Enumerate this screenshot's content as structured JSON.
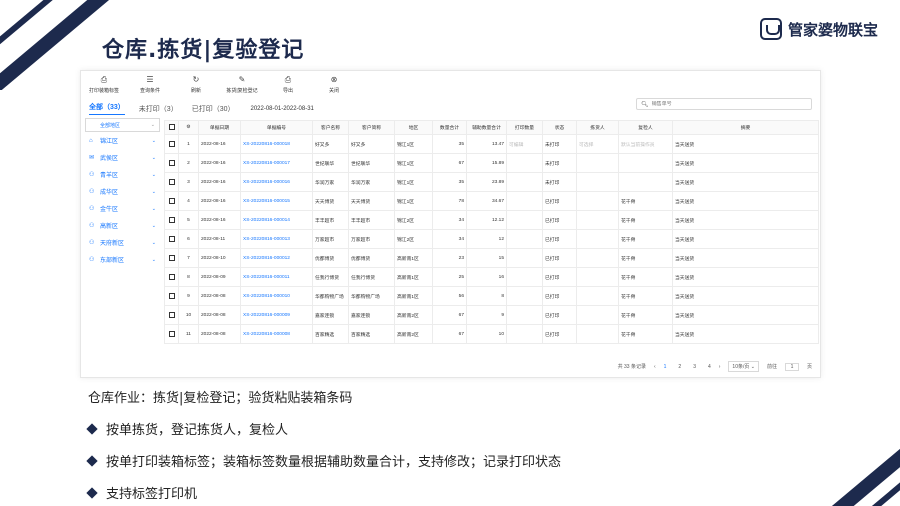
{
  "page": {
    "title": "仓库.拣货|复验登记",
    "brand": "管家婆物联宝"
  },
  "toolbar": [
    {
      "label": "打印装箱标签",
      "icon": "printer-icon"
    },
    {
      "label": "查询条件",
      "icon": "filter-icon"
    },
    {
      "label": "刷新",
      "icon": "refresh-icon"
    },
    {
      "label": "拣货|复检登记",
      "icon": "edit-icon"
    },
    {
      "label": "导出",
      "icon": "export-icon"
    },
    {
      "label": "关闭",
      "icon": "close-icon"
    }
  ],
  "tabs": [
    {
      "label": "全部（33）",
      "active": true
    },
    {
      "label": "未打印（3）",
      "active": false
    },
    {
      "label": "已打印（30）",
      "active": false
    }
  ],
  "date_range": "2022-08-01-2022-08-31",
  "search": {
    "placeholder": "销售单号"
  },
  "sidebar": {
    "select": "全部地区",
    "items": [
      {
        "label": "锦江区",
        "icon": "home-icon"
      },
      {
        "label": "武侯区",
        "icon": "mail-icon"
      },
      {
        "label": "青羊区",
        "icon": "user-icon"
      },
      {
        "label": "成华区",
        "icon": "user-icon"
      },
      {
        "label": "金牛区",
        "icon": "user-icon"
      },
      {
        "label": "高新区",
        "icon": "user-icon"
      },
      {
        "label": "天府新区",
        "icon": "user-icon"
      },
      {
        "label": "东部新区",
        "icon": "user-icon"
      }
    ]
  },
  "table": {
    "headers": [
      "",
      "",
      "单据日期",
      "单据编号",
      "客户名称",
      "客户简称",
      "地区",
      "数量合计",
      "辅助数量合计",
      "打印数量",
      "状态",
      "拣货人",
      "复检人",
      "摘要"
    ],
    "rows": [
      [
        "1",
        "2022-08-16",
        "XS-20220816-000018",
        "好又多",
        "好又多",
        "锦江1区",
        "35",
        "13.47",
        "可编辑",
        "未打印",
        "可选择",
        "默认当前操作员",
        "当天送货"
      ],
      [
        "2",
        "2022-08-16",
        "XS-20220816-000017",
        "世纪联华",
        "世纪联华",
        "锦江1区",
        "67",
        "15.89",
        "",
        "未打印",
        "",
        "",
        "当天送货"
      ],
      [
        "3",
        "2022-08-16",
        "XS-20220816-000016",
        "华润万家",
        "华润万家",
        "锦江1区",
        "35",
        "23.89",
        "",
        "未打印",
        "",
        "",
        "当天送货"
      ],
      [
        "4",
        "2022-08-16",
        "XS-20220816-000015",
        "天天博货",
        "天天博货",
        "锦江1区",
        "78",
        "34.67",
        "",
        "已打印",
        "",
        "花千骨",
        "当天送货"
      ],
      [
        "5",
        "2022-08-16",
        "XS-20220816-000014",
        "丰丰超市",
        "丰丰超市",
        "锦江2区",
        "34",
        "12.12",
        "",
        "已打印",
        "",
        "花千骨",
        "当天送货"
      ],
      [
        "6",
        "2022-08-11",
        "XS-20220816-000013",
        "万家超市",
        "万家超市",
        "锦江2区",
        "34",
        "12",
        "",
        "已打印",
        "",
        "花千骨",
        "当天送货"
      ],
      [
        "7",
        "2022-08-10",
        "XS-20220816-000012",
        "优都博货",
        "优都博货",
        "高新南1区",
        "23",
        "15",
        "",
        "已打印",
        "",
        "花千骨",
        "当天送货"
      ],
      [
        "8",
        "2022-08-09",
        "XS-20220816-000011",
        "任我行博货",
        "任我行博货",
        "高新南1区",
        "25",
        "16",
        "",
        "已打印",
        "",
        "花千骨",
        "当天送货"
      ],
      [
        "9",
        "2022-08-08",
        "XS-20220816-000010",
        "华都购物广场",
        "华都购物广场",
        "高新南1区",
        "56",
        "8",
        "",
        "已打印",
        "",
        "花千骨",
        "当天送货"
      ],
      [
        "10",
        "2022-08-08",
        "XS-20220816-000009",
        "嘉家连锁",
        "嘉家连锁",
        "高新南2区",
        "67",
        "9",
        "",
        "已打印",
        "",
        "花千骨",
        "当天送货"
      ],
      [
        "11",
        "2022-08-08",
        "XS-20220816-000008",
        "百家精选",
        "百家精选",
        "高新南2区",
        "67",
        "10",
        "",
        "已打印",
        "",
        "花千骨",
        "当天送货"
      ]
    ]
  },
  "pager": {
    "total": "共 33 条记录",
    "pages": [
      "1",
      "2",
      "3",
      "4"
    ],
    "active_page": "1",
    "page_size": "10条/页",
    "goto_label": "前往",
    "goto_value": "1",
    "page_unit": "页"
  },
  "bottom": {
    "caption": "仓库作业：拣货|复检登记；验货粘贴装箱条码",
    "bullets": [
      "按单拣货，登记拣货人，复检人",
      "按单打印装箱标签；装箱标签数量根据辅助数量合计，支持修改；记录打印状态",
      "支持标签打印机"
    ]
  },
  "colors": {
    "navy": "#1d2a4d",
    "accent": "#1677ff"
  }
}
